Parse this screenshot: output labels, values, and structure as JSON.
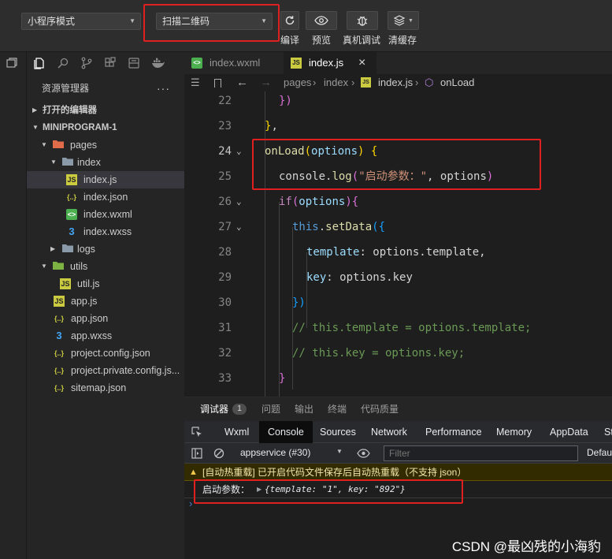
{
  "toolbar": {
    "mode_select": "小程序模式",
    "compile_select": "扫描二维码",
    "compile_label": "编译",
    "preview_label": "预览",
    "remote_debug_label": "真机调试",
    "clear_cache_label": "清缓存"
  },
  "explorer": {
    "title": "资源管理器",
    "more": "···",
    "open_editors": "打开的编辑器",
    "project": "MINIPROGRAM-1",
    "tree": [
      {
        "name": "pages"
      },
      {
        "name": "index"
      },
      {
        "name": "index.js"
      },
      {
        "name": "index.json"
      },
      {
        "name": "index.wxml"
      },
      {
        "name": "index.wxss"
      },
      {
        "name": "logs"
      },
      {
        "name": "utils"
      },
      {
        "name": "util.js"
      },
      {
        "name": "app.js"
      },
      {
        "name": "app.json"
      },
      {
        "name": "app.wxss"
      },
      {
        "name": "project.config.json"
      },
      {
        "name": "project.private.config.js..."
      },
      {
        "name": "sitemap.json"
      }
    ],
    "icon_labels": {
      "js": "JS",
      "json": "{..}",
      "wxml": "<>",
      "wxss": "3"
    }
  },
  "editor": {
    "tabs": [
      {
        "label": "index.wxml"
      },
      {
        "label": "index.js"
      }
    ],
    "close_glyph": "×",
    "breadcrumb": [
      "pages",
      "index",
      "index.js",
      "onLoad"
    ],
    "line_numbers": [
      "22",
      "23",
      "24",
      "25",
      "26",
      "27",
      "28",
      "29",
      "30",
      "31",
      "32",
      "33"
    ],
    "code": {
      "l22": "})",
      "l23_a": "}",
      "l23_b": ",",
      "l24_a": "onLoad",
      "l24_b": "(",
      "l24_c": "options",
      "l24_d": ")",
      "l24_e": "{",
      "l25_a": "console",
      "l25_b": ".",
      "l25_c": "log",
      "l25_d": "(",
      "l25_e": "\"启动参数：\"",
      "l25_f": ", options",
      "l25_g": ")",
      "l26_a": "if",
      "l26_b": "(",
      "l26_c": "options",
      "l26_d": "){",
      "l27_a": "this",
      "l27_b": ".",
      "l27_c": "setData",
      "l27_d": "({",
      "l28_a": "template",
      "l28_b": ": options.template,",
      "l29_a": "key",
      "l29_b": ": options.key",
      "l30": "})",
      "l31": "// this.template = options.template;",
      "l32": "// this.key = options.key;",
      "l33": "}"
    }
  },
  "panel": {
    "tabs": [
      "调试器",
      "问题",
      "输出",
      "终端",
      "代码质量"
    ],
    "debugger_badge": "1",
    "devtools_tabs": [
      "Wxml",
      "Console",
      "Sources",
      "Network",
      "Performance",
      "Memory",
      "AppData",
      "St"
    ],
    "context": "appservice (#30)",
    "filter_placeholder": "Filter",
    "levels": "Defau",
    "warning": "[自动热重载] 已开启代码文件保存后自动热重载（不支持 json）",
    "log_label": "启动参数：",
    "log_object": "{template: \"1\", key: \"892\"}",
    "prompt": "›"
  },
  "watermark": "CSDN @最凶残的小海豹",
  "colors": {
    "highlight_box": "#e02020",
    "keyword": "#c586c0",
    "function": "#dcdcaa",
    "parameter": "#9cdcfe",
    "string": "#ce9178",
    "comment": "#6a9955",
    "warning_bg": "#332b00"
  }
}
